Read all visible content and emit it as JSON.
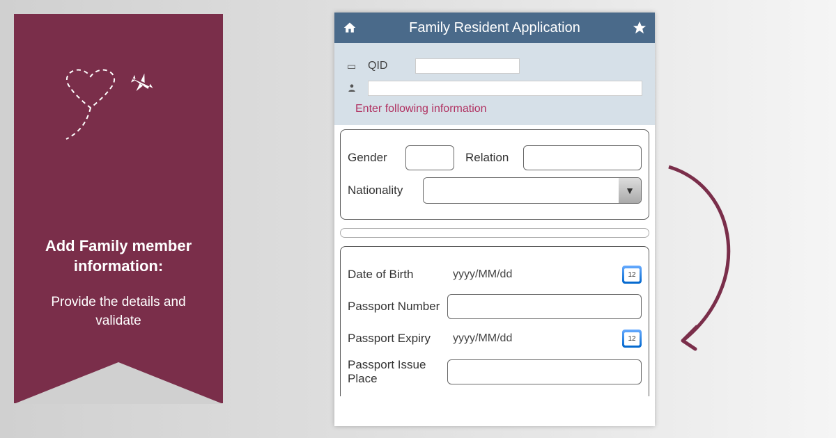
{
  "banner": {
    "title": "Add Family member information:",
    "subtitle": "Provide the details and validate"
  },
  "app": {
    "header_title": "Family Resident Application",
    "qid_label": "QID",
    "instruction": "Enter following information",
    "labels": {
      "gender": "Gender",
      "relation": "Relation",
      "nationality": "Nationality",
      "dob": "Date of Birth",
      "passport_number": "Passport Number",
      "passport_expiry": "Passport Expiry",
      "passport_issue_place": "Passport Issue Place"
    },
    "placeholders": {
      "date_format": "yyyy/MM/dd"
    },
    "cal_day": "12"
  }
}
